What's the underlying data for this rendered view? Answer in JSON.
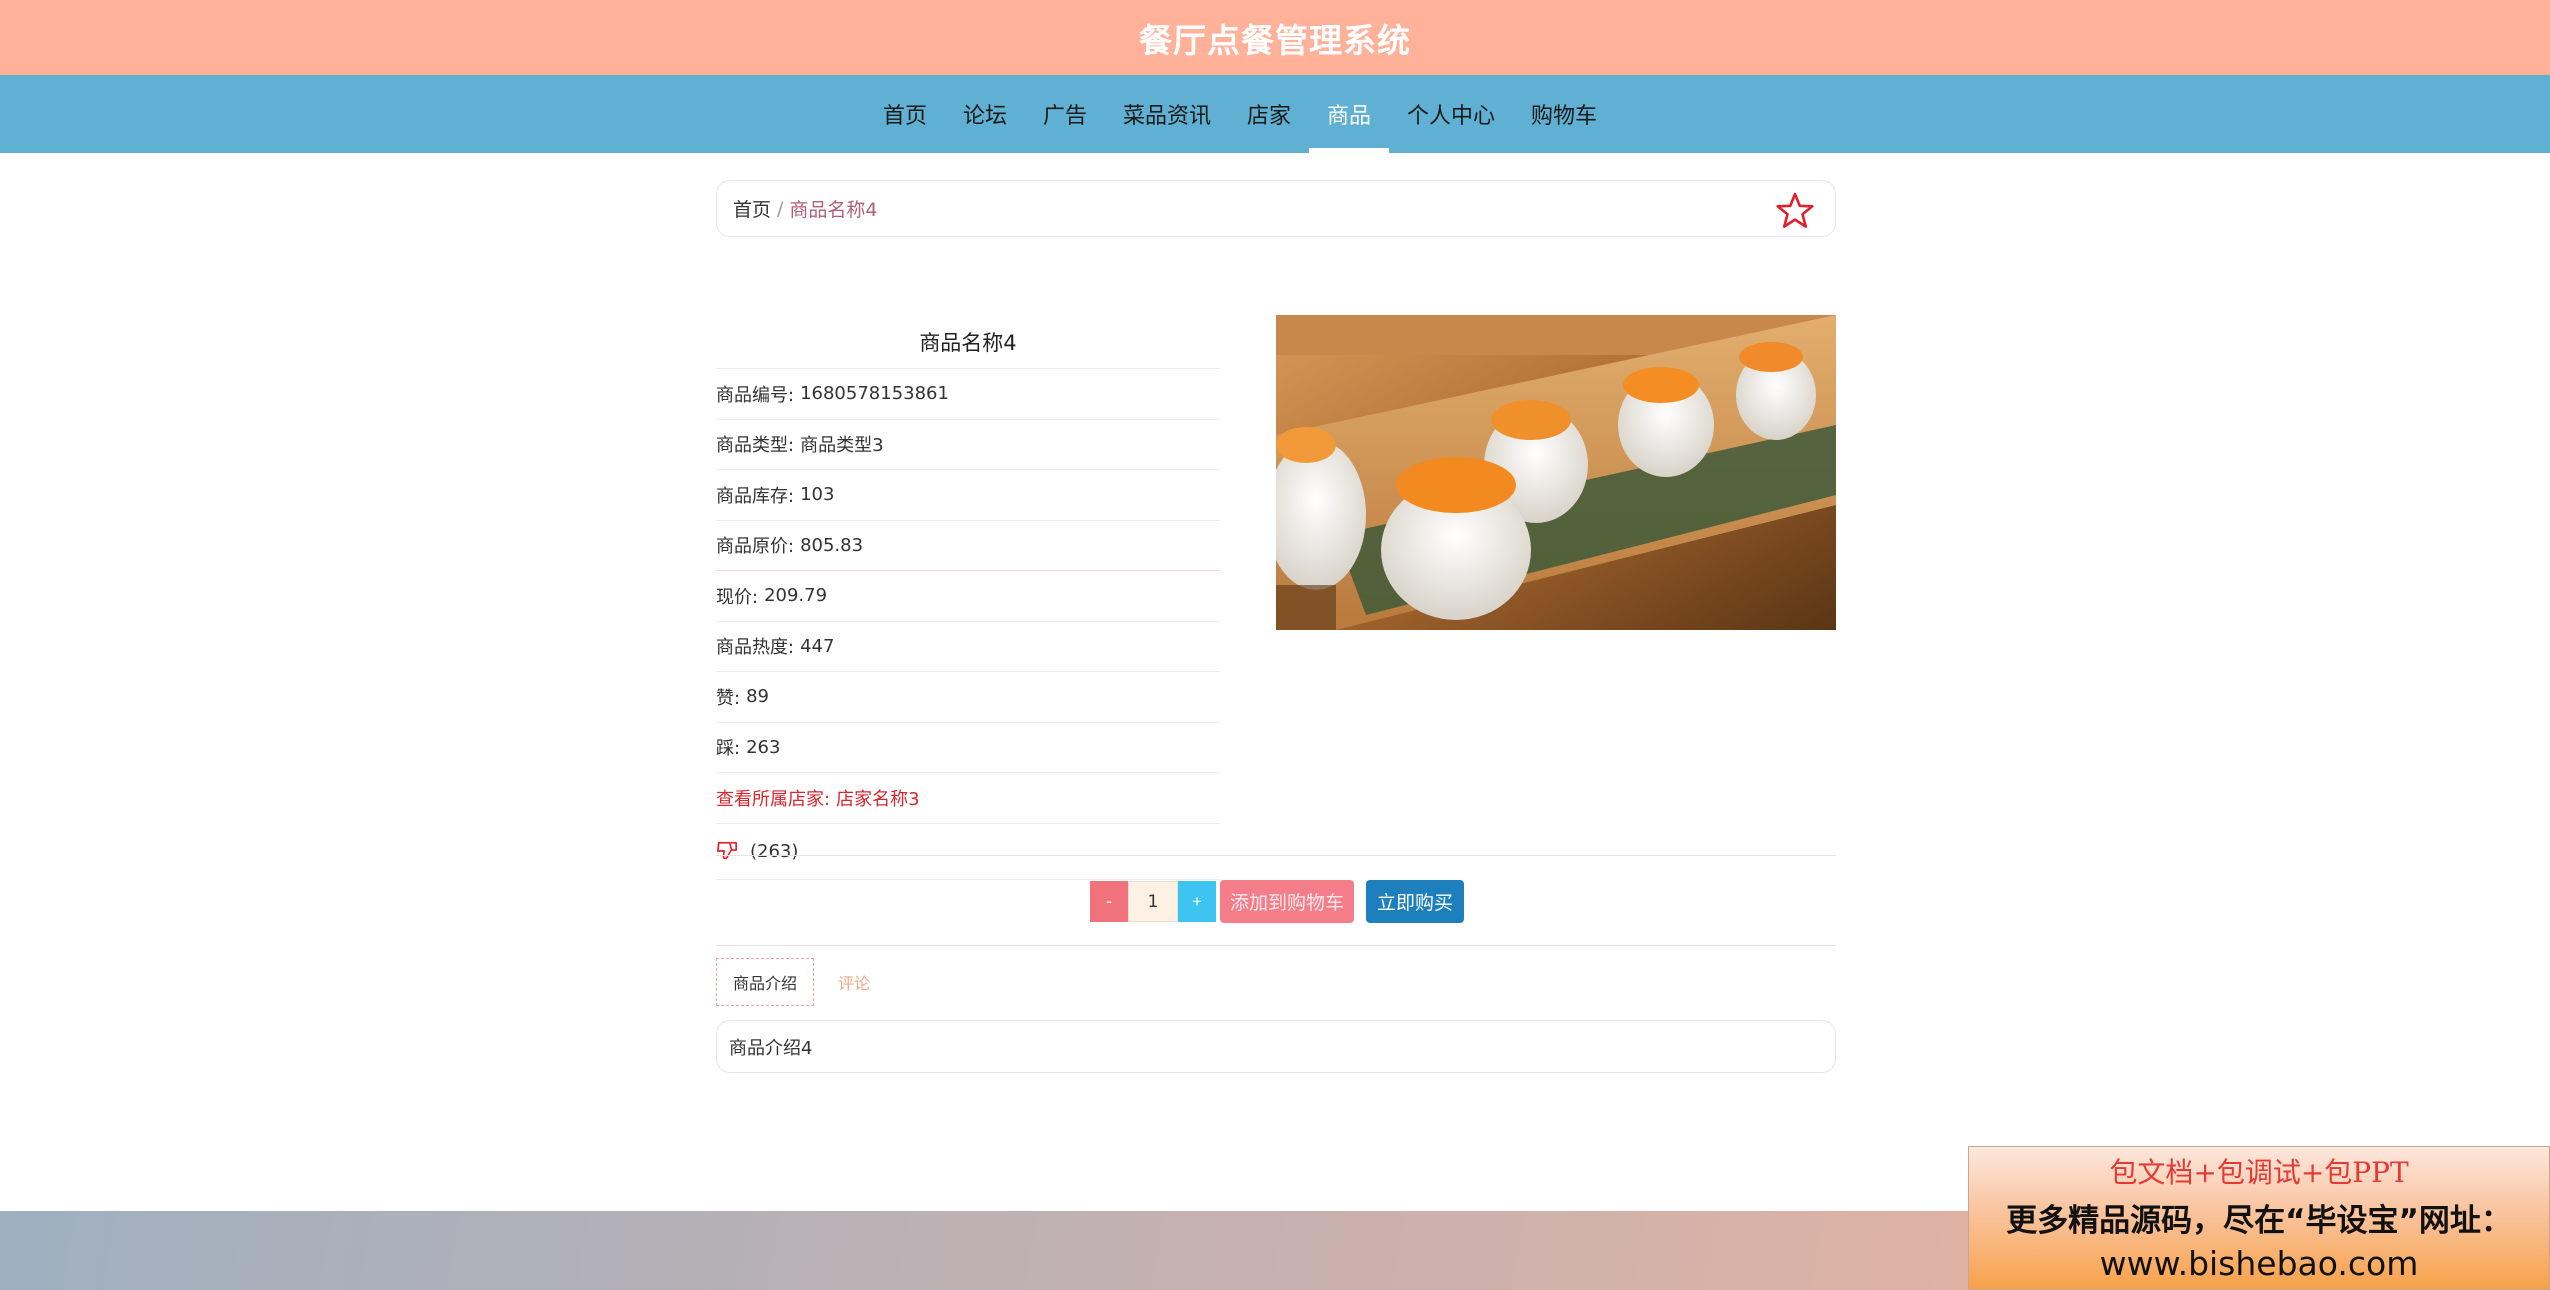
{
  "header": {
    "title": "餐厅点餐管理系统"
  },
  "nav": {
    "items": [
      {
        "label": "首页",
        "active": false
      },
      {
        "label": "论坛",
        "active": false
      },
      {
        "label": "广告",
        "active": false
      },
      {
        "label": "菜品资讯",
        "active": false
      },
      {
        "label": "店家",
        "active": false
      },
      {
        "label": "商品",
        "active": true
      },
      {
        "label": "个人中心",
        "active": false
      },
      {
        "label": "购物车",
        "active": false
      }
    ]
  },
  "breadcrumb": {
    "home": "首页",
    "separator": "/",
    "current": "商品名称4"
  },
  "product": {
    "name": "商品名称4",
    "fields": [
      {
        "label": "商品编号:",
        "value": "1680578153861"
      },
      {
        "label": "商品类型:",
        "value": "商品类型3"
      },
      {
        "label": "商品库存:",
        "value": "103"
      },
      {
        "label": "商品原价:",
        "value": "805.83"
      },
      {
        "label": "现价:",
        "value": "209.79"
      },
      {
        "label": "商品热度:",
        "value": "447"
      },
      {
        "label": "赞:",
        "value": "89"
      },
      {
        "label": "踩:",
        "value": "263"
      }
    ],
    "shop_link": {
      "label": "查看所属店家:",
      "value": "店家名称3"
    },
    "dislike_count": "(263)",
    "image_icon": "sushi-photo"
  },
  "purchase": {
    "minus": "-",
    "quantity": "1",
    "plus": "+",
    "add_to_cart": "添加到购物车",
    "buy_now": "立即购买"
  },
  "tabs": [
    {
      "label": "商品介绍",
      "active": true
    },
    {
      "label": "评论",
      "active": false
    }
  ],
  "description": "商品介绍4",
  "promo": {
    "line1": "包文档+包调试+包PPT",
    "line2": "更多精品源码，尽在“毕设宝”网址：",
    "line3": "www.bishebao.com"
  },
  "colors": {
    "title_bar": "#ffb19a",
    "nav_bar": "#5fb0d2",
    "shop_link": "#d8262d",
    "btn_cart": "#f37d88",
    "btn_buy": "#1d7fbb",
    "qty_plus": "#3ec4f1",
    "qty_minus": "#f0727a"
  }
}
